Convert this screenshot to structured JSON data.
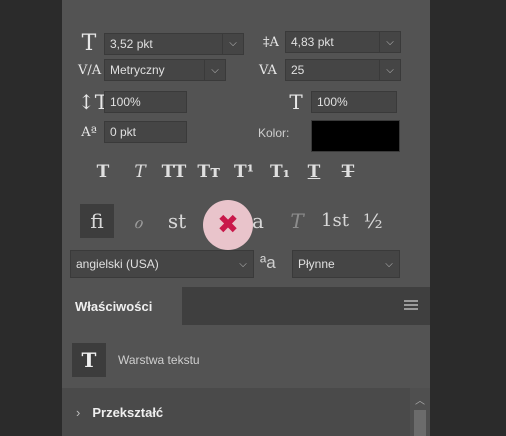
{
  "character": {
    "font_size": "3,52 pkt",
    "leading": "4,83 pkt",
    "kerning": "Metryczny",
    "tracking": "25",
    "vertical_scale": "100%",
    "horizontal_scale": "100%",
    "baseline_shift": "0 pkt",
    "color_label": "Kolor:",
    "color_value": "#000000",
    "language": "angielski (USA)",
    "antialias": "Płynne"
  },
  "typo_buttons": [
    "T",
    "T",
    "TT",
    "Tт",
    "T¹",
    "T₁",
    "T",
    "T"
  ],
  "opentype_buttons": [
    "fi",
    "ℴ",
    "st",
    "a",
    "T",
    "1st",
    "½"
  ],
  "properties": {
    "tab_label": "Właściwości",
    "layer_label": "Warstwa tekstu",
    "section_label": "Przekształć"
  },
  "colors": {
    "panel": "#535353",
    "close_circle": "#e9c4cb",
    "close_x": "#c9184a"
  }
}
